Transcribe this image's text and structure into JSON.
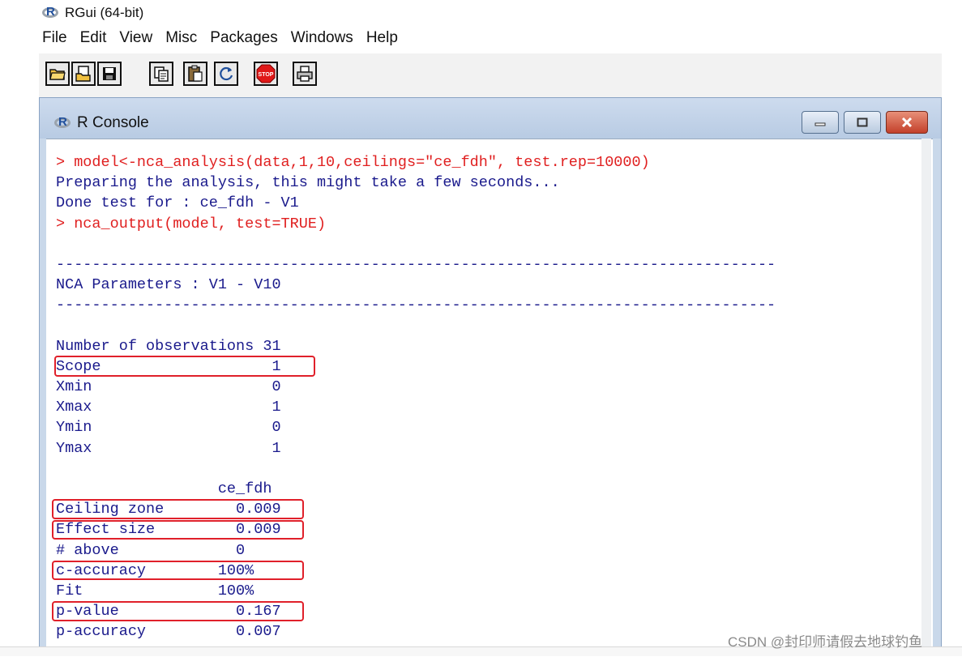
{
  "app": {
    "title": "RGui (64-bit)",
    "logo_letter": "R"
  },
  "menubar": {
    "items": [
      {
        "name": "menu-file",
        "label": "File"
      },
      {
        "name": "menu-edit",
        "label": "Edit"
      },
      {
        "name": "menu-view",
        "label": "View"
      },
      {
        "name": "menu-misc",
        "label": "Misc"
      },
      {
        "name": "menu-packages",
        "label": "Packages"
      },
      {
        "name": "menu-windows",
        "label": "Windows"
      },
      {
        "name": "menu-help",
        "label": "Help"
      }
    ]
  },
  "toolbar": {
    "buttons": [
      {
        "name": "open-script-button",
        "icon": "open-folder-icon"
      },
      {
        "name": "load-workspace-button",
        "icon": "load-workspace-icon"
      },
      {
        "name": "save-workspace-button",
        "icon": "save-icon"
      },
      {
        "name": "copy-button",
        "icon": "copy-icon"
      },
      {
        "name": "paste-button",
        "icon": "paste-icon"
      },
      {
        "name": "copy-paste-button",
        "icon": "refresh-icon"
      },
      {
        "name": "stop-button",
        "icon": "stop-icon",
        "label": "STOP"
      },
      {
        "name": "print-button",
        "icon": "print-icon"
      }
    ]
  },
  "console": {
    "title": "R Console",
    "lines": [
      {
        "text": "> model<-nca_analysis(data,1,10,ceilings=\"ce_fdh\", test.rep=10000)",
        "type": "input"
      },
      {
        "text": "Preparing the analysis, this might take a few seconds...",
        "type": "output"
      },
      {
        "text": "Done test for : ce_fdh - V1",
        "type": "output"
      },
      {
        "text": "> nca_output(model, test=TRUE)",
        "type": "input"
      },
      {
        "text": "",
        "type": "output"
      },
      {
        "text": "--------------------------------------------------------------------------------",
        "type": "output"
      },
      {
        "text": "NCA Parameters : V1 - V10",
        "type": "output"
      },
      {
        "text": "--------------------------------------------------------------------------------",
        "type": "output"
      },
      {
        "text": "",
        "type": "output"
      },
      {
        "text": "Number of observations 31",
        "type": "output"
      },
      {
        "text": "Scope                   1",
        "type": "output"
      },
      {
        "text": "Xmin                    0",
        "type": "output"
      },
      {
        "text": "Xmax                    1",
        "type": "output"
      },
      {
        "text": "Ymin                    0",
        "type": "output"
      },
      {
        "text": "Ymax                    1",
        "type": "output"
      },
      {
        "text": "",
        "type": "output"
      },
      {
        "text": "                  ce_fdh",
        "type": "output"
      },
      {
        "text": "Ceiling zone        0.009",
        "type": "output"
      },
      {
        "text": "Effect size         0.009",
        "type": "output"
      },
      {
        "text": "# above             0",
        "type": "output"
      },
      {
        "text": "c-accuracy        100%",
        "type": "output"
      },
      {
        "text": "Fit               100%",
        "type": "output"
      },
      {
        "text": "p-value             0.167",
        "type": "output"
      },
      {
        "text": "p-accuracy          0.007",
        "type": "output"
      }
    ]
  },
  "watermark": "CSDN @封印师请假去地球钓鱼",
  "colors": {
    "input_text": "#e02020",
    "output_text": "#1a1a8c",
    "highlight_box": "#e0202a"
  }
}
